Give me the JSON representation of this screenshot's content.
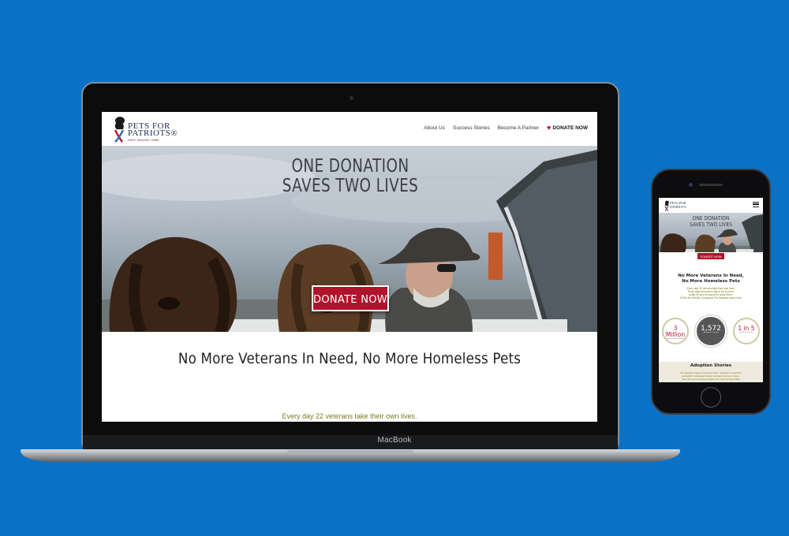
{
  "laptop": {
    "brand_label": "MacBook",
    "site": {
      "logo": {
        "line1": "PETS FOR",
        "line2": "PATRIOTS®",
        "tagline": "HOPE. HEALING. HOME."
      },
      "nav": {
        "about": "About Us",
        "stories": "Success Stories",
        "partner": "Become A Partner",
        "donate": "DONATE NOW"
      },
      "hero": {
        "title_line1": "ONE DONATION",
        "title_line2": "SAVES TWO LIVES",
        "donate_button": "DONATE NOW"
      },
      "section": {
        "title": "No More Veterans In Need, No More Homeless Pets",
        "subtitle": "Every day 22 veterans take their own lives."
      }
    }
  },
  "phone": {
    "site": {
      "logo": {
        "line1": "PETS FOR",
        "line2": "PATRIOTS"
      },
      "hero": {
        "title_line1": "ONE DONATION",
        "title_line2": "SAVES TWO LIVES",
        "donate_button": "DONATE NOW"
      },
      "section": {
        "title_line1": "No More Veterans In Need,",
        "title_line2": "No More Homeless Pets",
        "body_line1": "Every day 22 veterans take their own lives.",
        "body_line2": "Every eight seconds a dog or cat is put to",
        "body_line3": "death for lack of anyone to adopt them.",
        "body_line4": "A Pets for Patriots Companion Pet Adoption saves both."
      },
      "stats": [
        {
          "number": "3 Million",
          "label": "pets in animal shelters"
        },
        {
          "number": "1,572",
          "label": "Shepherd Counting"
        },
        {
          "number": "1 in 5",
          "label": "post-9/11 veterans"
        }
      ],
      "adoption": {
        "title": "Adoption Stories",
        "line1": "Our special program saves two lives: veterans in need find",
        "line2": "and adopt overlooked shelter animals a Forever Home.",
        "line3": "Here are some success stories from The Pet Hero Blog"
      }
    }
  },
  "colors": {
    "background": "#0a72c6",
    "accent_red": "#b0132c",
    "olive_text": "#7a7a1e"
  }
}
